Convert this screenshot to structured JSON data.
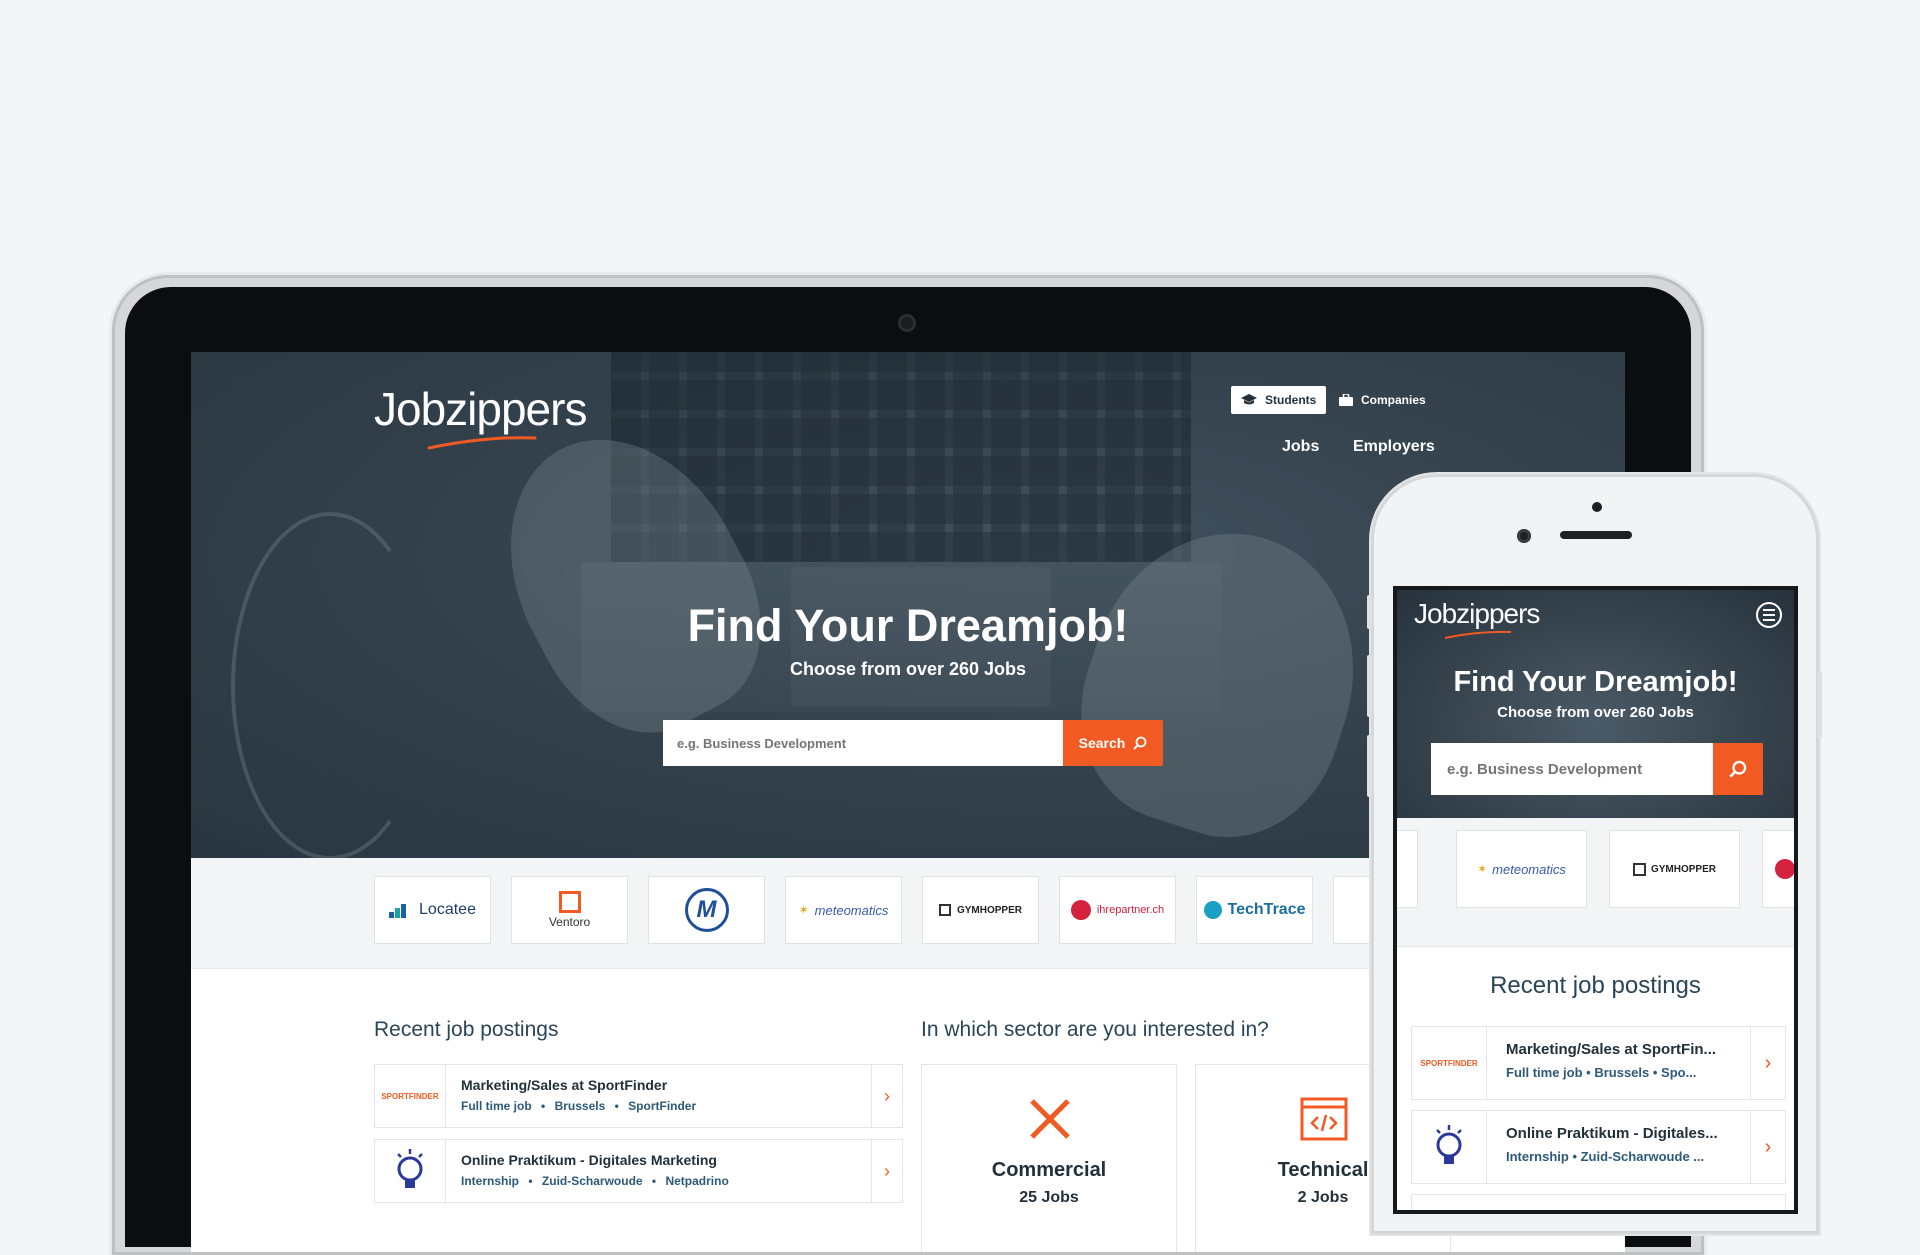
{
  "brand": {
    "name": "Jobzippers",
    "accent": "#f15a22",
    "hero_overlay": "#3b4954",
    "heading_color": "#2a4558"
  },
  "desktop": {
    "segments": [
      {
        "label": "Students",
        "icon": "graduation-cap-icon",
        "active": true
      },
      {
        "label": "Companies",
        "icon": "briefcase-icon",
        "active": false
      }
    ],
    "nav": {
      "jobs": "Jobs",
      "employers": "Employers"
    },
    "hero": {
      "title": "Find Your Dreamjob!",
      "subtitle": "Choose from over 260 Jobs",
      "search_placeholder": "e.g. Business Development",
      "search_button": "Search"
    },
    "company_logos": [
      "Locatee",
      "Ventoro",
      "M",
      "meteomatics",
      "GYMHOPPER",
      "ihrepartner.ch",
      "TechTrace"
    ],
    "recent_title": "Recent job postings",
    "jobs": [
      {
        "title": "Marketing/Sales at SportFinder",
        "type": "Full time job",
        "location": "Brussels",
        "company": "SportFinder",
        "logo": "SPORTFINDER"
      },
      {
        "title": "Online Praktikum - Digitales Marketing",
        "type": "Internship",
        "location": "Zuid-Scharwoude",
        "company": "Netpadrino",
        "logo": "lightbulb"
      }
    ],
    "sector_title": "In which sector are you interested in?",
    "sectors": [
      {
        "name": "Commercial",
        "count": "25 Jobs",
        "icon": "pencil-ruler-icon"
      },
      {
        "name": "Technical",
        "count": "2 Jobs",
        "icon": "code-window-icon"
      }
    ]
  },
  "mobile": {
    "hero": {
      "title": "Find Your Dreamjob!",
      "subtitle": "Choose from over 260 Jobs",
      "search_placeholder": "e.g. Business Development"
    },
    "company_logos": [
      "meteomatics",
      "GYMHOPPER"
    ],
    "recent_title": "Recent job postings",
    "jobs": [
      {
        "title": "Marketing/Sales at SportFin...",
        "meta": "Full time job  •  Brussels  •  Spo..."
      },
      {
        "title": "Online Praktikum - Digitales...",
        "meta": "Internship  •  Zuid-Scharwoude ..."
      }
    ]
  }
}
